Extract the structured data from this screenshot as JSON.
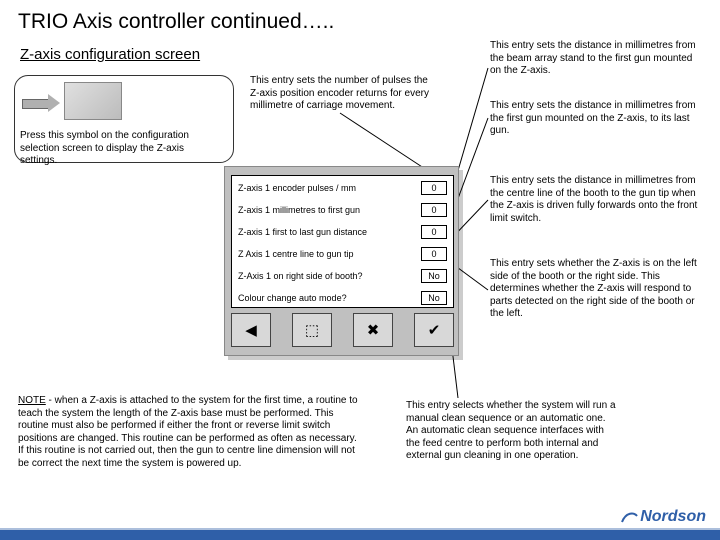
{
  "title": "TRIO Axis controller continued…..",
  "subtitle": "Z-axis configuration screen",
  "callouts": {
    "pulses": "This entry sets the number of pulses the Z-axis position encoder returns for every millimetre of carriage movement.",
    "beam_to_first": "This entry sets the distance in millimetres from the beam array stand to the first gun mounted on the Z-axis.",
    "first_to_last": "This entry sets the distance in millimetres from the first gun mounted on the Z-axis, to its last gun.",
    "centre_to_tip": "This entry sets the distance in millimetres from the centre line of the booth to the gun tip when the Z-axis is driven fully forwards onto the front limit switch.",
    "right_side": "This entry sets whether the Z-axis is on the left side of the booth or the right side. This determines whether the Z-axis will respond to parts detected on the right side of the booth or the left.",
    "auto_mode": "This entry selects whether the system will run a manual clean sequence or an automatic one. An automatic clean sequence interfaces with the feed centre to perform both internal and external gun cleaning in one operation.",
    "press_symbol": "Press this symbol on the configuration selection screen to display the Z-axis settings."
  },
  "hmi": {
    "rows": [
      {
        "label": "Z-axis 1 encoder pulses / mm",
        "value": "0"
      },
      {
        "label": "Z-axis 1 millimetres to first gun",
        "value": "0"
      },
      {
        "label": "Z-axis 1 first to last gun distance",
        "value": "0"
      },
      {
        "label": "Z Axis 1 centre line to gun tip",
        "value": "0"
      },
      {
        "label": "Z-Axis 1 on right side of booth?",
        "value": "No"
      },
      {
        "label": "Colour change auto mode?",
        "value": "No"
      }
    ],
    "buttons": [
      "◀",
      "⬚",
      "✖",
      "✔"
    ]
  },
  "note": {
    "heading": "NOTE",
    "body": " - when a Z-axis is attached to the system for the first time, a routine to teach the system the length of the Z-axis base must be performed. This routine must also be performed if either the front or reverse limit switch positions are changed. This routine can be performed as often as necessary. If this routine is not carried out, then the gun to centre line dimension will not be correct the next time the system is powered up."
  },
  "brand": "Nordson"
}
